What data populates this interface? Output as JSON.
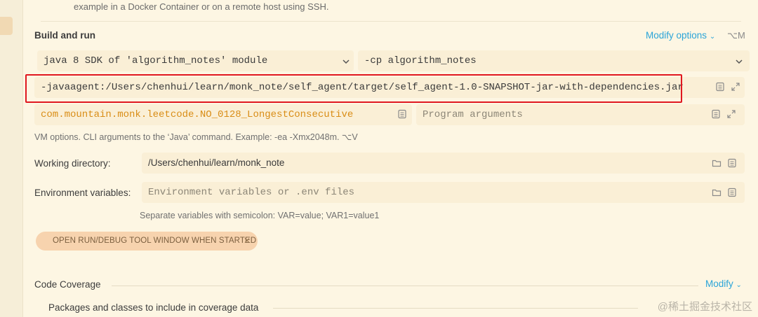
{
  "top_description": "example in a Docker Container or on a remote host using SSH.",
  "build_and_run": {
    "title": "Build and run",
    "modify_options": "Modify options",
    "modify_shortcut": "⌥M",
    "sdk_value": "java 8 SDK of 'algorithm_notes' module",
    "classpath_value": "-cp algorithm_notes",
    "vm_options_value": "-javaagent:/Users/chenhui/learn/monk_note/self_agent/target/self_agent-1.0-SNAPSHOT-jar-with-dependencies.jar",
    "main_class_value": "com.mountain.monk.leetcode.NO_0128_LongestConsecutive",
    "program_args_placeholder": "Program arguments",
    "vm_hint": "VM options. CLI arguments to the ‘Java’ command. Example: -ea -Xmx2048m. ⌥V"
  },
  "working_directory": {
    "label": "Working directory:",
    "value": "/Users/chenhui/learn/monk_note"
  },
  "environment": {
    "label": "Environment variables:",
    "placeholder": "Environment variables or .env files",
    "hint": "Separate variables with semicolon: VAR=value; VAR1=value1"
  },
  "chip_label": "OPEN RUN/DEBUG TOOL WINDOW WHEN STARTED",
  "code_coverage": {
    "title": "Code Coverage",
    "modify": "Modify",
    "packages_label": "Packages and classes to include in coverage data"
  },
  "watermark": "@稀土掘金技术社区",
  "colors": {
    "accent": "#2aa4d8",
    "highlight_border": "#e0171f",
    "main_class_text": "#d98d16",
    "background": "#fdf6e3"
  }
}
